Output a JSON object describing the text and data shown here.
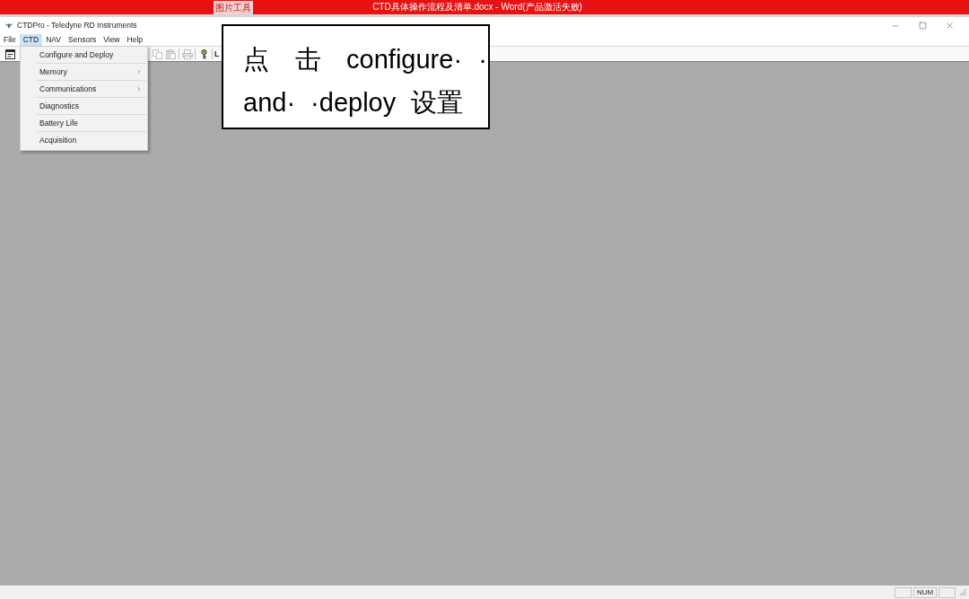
{
  "word_window": {
    "context_tab": "图片工具",
    "title": "CTD具体操作流程及清单.docx - Word(产品激活失败)"
  },
  "window": {
    "title": "CTDPro - Teledyne RD Instruments"
  },
  "menu": [
    {
      "label": "File",
      "selected": false
    },
    {
      "label": "CTD",
      "selected": true
    },
    {
      "label": "NAV",
      "selected": false
    },
    {
      "label": "Sensors",
      "selected": false
    },
    {
      "label": "View",
      "selected": false
    },
    {
      "label": "Help",
      "selected": false
    }
  ],
  "toolbar": {
    "buttons": [
      {
        "disabled": false
      },
      {
        "disabled": true
      },
      {
        "disabled": true
      },
      {
        "disabled": true
      },
      {
        "disabled": false
      }
    ],
    "partial_label": "L"
  },
  "dropdown": {
    "items": [
      {
        "label": "Configure and Deploy",
        "submenu": false
      },
      {
        "label": "Memory",
        "submenu": true
      },
      {
        "label": "Communications",
        "submenu": true
      },
      {
        "label": "Diagnostics",
        "submenu": false
      },
      {
        "label": "Battery Life",
        "submenu": false
      },
      {
        "label": "Acquisition",
        "submenu": false
      }
    ]
  },
  "callout": {
    "lines": [
      "点 击 configure· ·",
      "and· ·deploy 设置"
    ]
  },
  "status_bar": {
    "panels": [
      {
        "kind": "empty"
      },
      {
        "kind": "text",
        "text": "NUM"
      },
      {
        "kind": "empty"
      }
    ]
  }
}
